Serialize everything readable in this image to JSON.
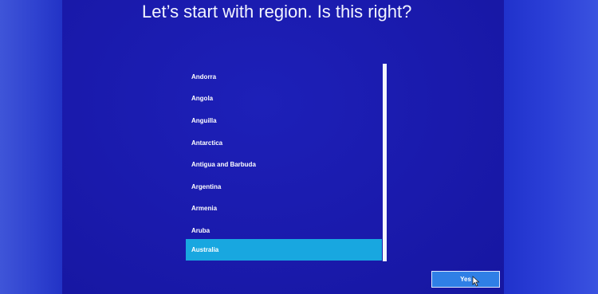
{
  "page": {
    "title": "Let’s start with region. Is this right?"
  },
  "region_list": {
    "items": [
      {
        "label": "Andorra",
        "selected": false
      },
      {
        "label": "Angola",
        "selected": false
      },
      {
        "label": "Anguilla",
        "selected": false
      },
      {
        "label": "Antarctica",
        "selected": false
      },
      {
        "label": "Antigua and Barbuda",
        "selected": false
      },
      {
        "label": "Argentina",
        "selected": false
      },
      {
        "label": "Armenia",
        "selected": false
      },
      {
        "label": "Aruba",
        "selected": false
      },
      {
        "label": "Australia",
        "selected": true
      }
    ],
    "selected_color": "#18a7e0"
  },
  "actions": {
    "yes_label": "Yes"
  },
  "colors": {
    "background": "#1a1aac",
    "accent": "#18a7e0",
    "button": "#2f7fe6"
  },
  "icons": {
    "pointer": "mouse-pointer-icon"
  }
}
